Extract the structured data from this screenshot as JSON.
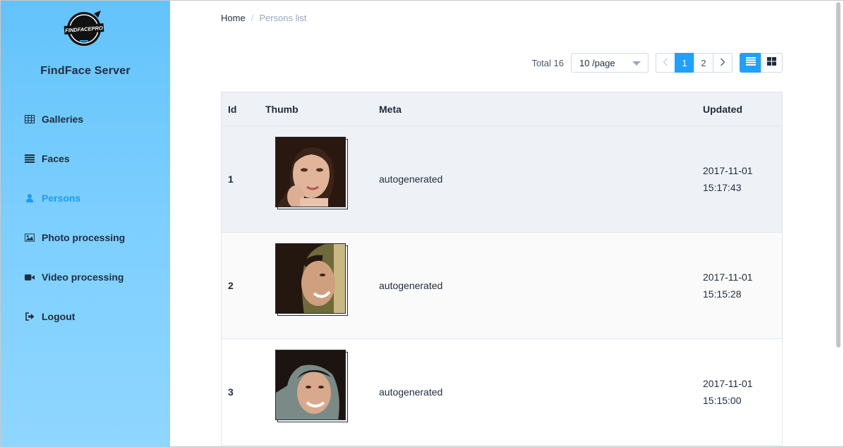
{
  "app": {
    "brand": "FindFace Server",
    "logo_text": "FINDFACEPRO"
  },
  "sidebar": {
    "items": [
      {
        "label": "Galleries",
        "icon": "table-icon",
        "active": false
      },
      {
        "label": "Faces",
        "icon": "list-icon",
        "active": false
      },
      {
        "label": "Persons",
        "icon": "user-icon",
        "active": true
      },
      {
        "label": "Photo processing",
        "icon": "image-icon",
        "active": false
      },
      {
        "label": "Video processing",
        "icon": "video-camera-icon",
        "active": false
      },
      {
        "label": "Logout",
        "icon": "logout-icon",
        "active": false
      }
    ]
  },
  "breadcrumb": {
    "home": "Home",
    "separator": "/",
    "current": "Persons list"
  },
  "toolbar": {
    "total": "Total 16",
    "page_size": "10 /page",
    "pages": [
      "1",
      "2"
    ],
    "current_page": "1",
    "views": [
      "list-view-icon",
      "grid-view-icon"
    ]
  },
  "table": {
    "columns": {
      "id": "Id",
      "thumb": "Thumb",
      "meta": "Meta",
      "updated": "Updated"
    },
    "rows": [
      {
        "id": "1",
        "meta": "autogenerated",
        "updated_date": "2017-11-01",
        "updated_time": "15:17:43"
      },
      {
        "id": "2",
        "meta": "autogenerated",
        "updated_date": "2017-11-01",
        "updated_time": "15:15:28"
      },
      {
        "id": "3",
        "meta": "autogenerated",
        "updated_date": "2017-11-01",
        "updated_time": "15:15:00"
      }
    ]
  },
  "colors": {
    "accent": "#20a0ff",
    "sidebar_top": "#63c3fb",
    "sidebar_bottom": "#8fd6ff",
    "active_nav": "#1e9bf0"
  }
}
